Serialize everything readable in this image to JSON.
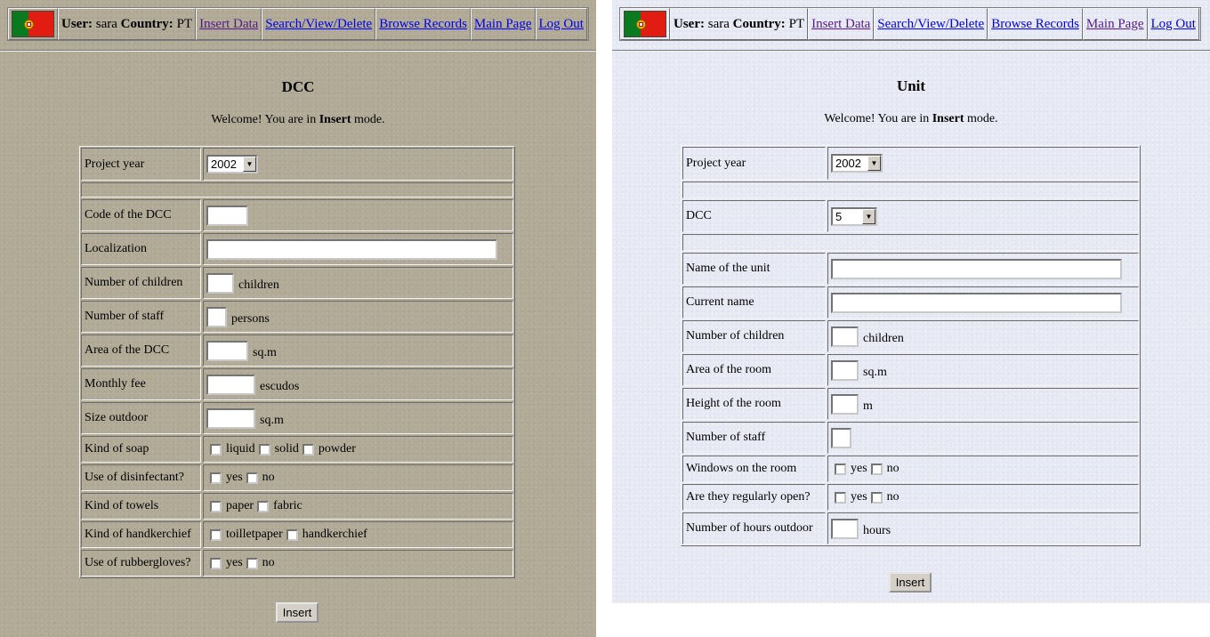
{
  "nav": {
    "user_label": "User:",
    "user_name": "sara",
    "country_label": "Country:",
    "country_code": "PT",
    "links": [
      "Insert Data",
      "Search/View/Delete",
      "Browse Records",
      "Main Page",
      "Log Out"
    ]
  },
  "welcome": {
    "prefix": "Welcome! You are in ",
    "mode": "Insert",
    "suffix": " mode."
  },
  "left_form": {
    "title": "DCC",
    "project_year_label": "Project year",
    "project_year_value": "2002",
    "code_label": "Code of the DCC",
    "localization_label": "Localization",
    "children_label": "Number of children",
    "children_unit": "children",
    "staff_label": "Number of staff",
    "staff_unit": "persons",
    "area_label": "Area of the DCC",
    "area_unit": "sq.m",
    "fee_label": "Monthly fee",
    "fee_unit": "escudos",
    "outdoor_label": "Size outdoor",
    "outdoor_unit": "sq.m",
    "soap_label": "Kind of soap",
    "soap_options": [
      "liquid",
      "solid",
      "powder"
    ],
    "disinfectant_label": "Use of disinfectant?",
    "disinfectant_options": [
      "yes",
      "no"
    ],
    "towels_label": "Kind of towels",
    "towels_options": [
      "paper",
      "fabric"
    ],
    "handkerchief_label": "Kind of handkerchief",
    "handkerchief_options": [
      "toilletpaper",
      "handkerchief"
    ],
    "gloves_label": "Use of rubbergloves?",
    "gloves_options": [
      "yes",
      "no"
    ],
    "submit_label": "Insert"
  },
  "right_form": {
    "title": "Unit",
    "project_year_label": "Project year",
    "project_year_value": "2002",
    "dcc_label": "DCC",
    "dcc_value": "5",
    "unit_name_label": "Name of the unit",
    "current_name_label": "Current name",
    "children_label": "Number of children",
    "children_unit": "children",
    "room_area_label": "Area of the room",
    "room_area_unit": "sq.m",
    "room_height_label": "Height of the room",
    "room_height_unit": "m",
    "staff_label": "Number of staff",
    "windows_label": "Windows on the room",
    "windows_options": [
      "yes",
      "no"
    ],
    "open_label": "Are they regularly open?",
    "open_options": [
      "yes",
      "no"
    ],
    "outdoor_hours_label": "Number of hours outdoor",
    "outdoor_hours_unit": "hours",
    "submit_label": "Insert"
  }
}
